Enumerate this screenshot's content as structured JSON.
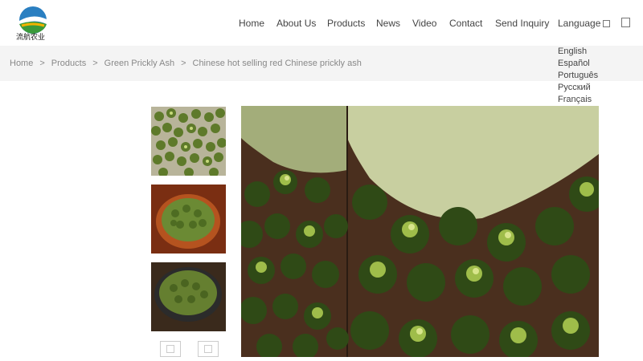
{
  "header": {
    "logo_text": "流航农业",
    "nav": [
      {
        "label": "Home"
      },
      {
        "label": "About Us"
      },
      {
        "label": "Products"
      },
      {
        "label": "News"
      },
      {
        "label": "Video"
      },
      {
        "label": "Contact"
      },
      {
        "label": "Send Inquiry"
      },
      {
        "label": "Language"
      }
    ]
  },
  "language_menu": [
    "English",
    "Español",
    "Português",
    "Русский",
    "Français"
  ],
  "breadcrumb": {
    "items": [
      "Home",
      "Products",
      "Green Prickly Ash",
      "Chinese hot selling red Chinese prickly ash"
    ],
    "separator": ">"
  },
  "truncated_text": "s",
  "colors": {
    "breadcrumb_bg": "#f4f4f4",
    "pepper_green": "#5e7a2a",
    "wood_brown": "#4a2f1e"
  },
  "gallery": {
    "prev_icon": "chevron-left-icon",
    "next_icon": "chevron-right-icon"
  }
}
